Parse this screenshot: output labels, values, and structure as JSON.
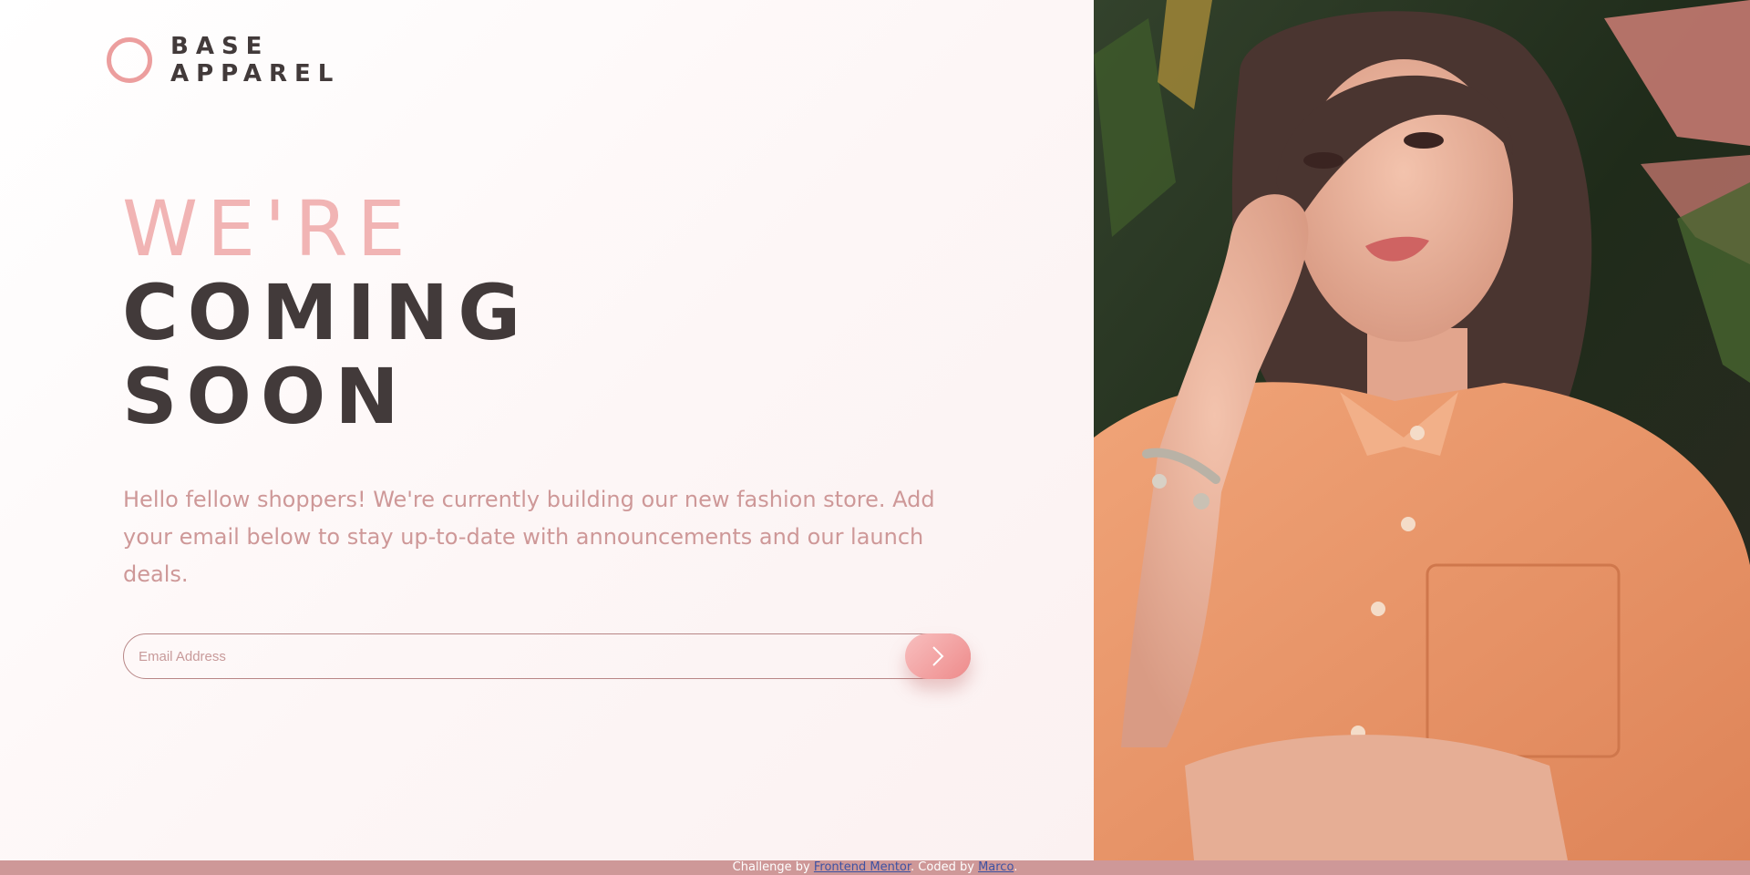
{
  "brand": {
    "line1": "BASE",
    "line2": "APPAREL",
    "accent_color": "#ec9e9e"
  },
  "headline": {
    "light": "WE'RE",
    "line2": "COMING",
    "line3": "SOON"
  },
  "intro": "Hello fellow shoppers! We're currently building our new fashion store. Add your email below to stay up-to-date with announcements and our launch deals.",
  "form": {
    "email_placeholder": "Email Address",
    "email_value": "",
    "submit_icon": "chevron-right-icon"
  },
  "hero": {
    "icon": "hero-photo-woman-orange-shirt"
  },
  "footer": {
    "prefix": "Challenge by",
    "challenge_link": "Frontend Mentor",
    "middle": ". Coded by",
    "author_link": "Marco",
    "suffix": "."
  },
  "colors": {
    "primary_text": "#423a3a",
    "desaturated_red": "#ce9898",
    "soft_red": "#f1b4b4",
    "footer_bg": "#ce9898"
  }
}
